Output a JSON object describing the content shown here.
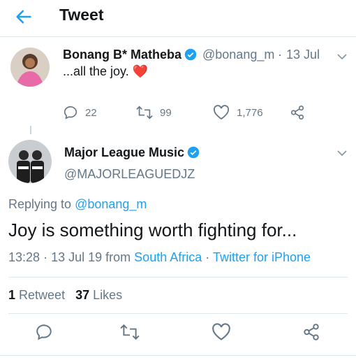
{
  "header": {
    "title": "Tweet"
  },
  "parent_tweet": {
    "display_name": "Bonang B* Matheba",
    "handle": "@bonang_m",
    "separator": "·",
    "date": "13 Jul",
    "text": "...all the joy.",
    "emoji": "❤️",
    "replies": "22",
    "retweets": "99",
    "likes": "1,776"
  },
  "main_tweet": {
    "display_name": "Major League Music",
    "handle": "@MAJORLEAGUEDJZ",
    "replying_prefix": "Replying to",
    "replying_to": "@bonang_m",
    "text": "Joy is something worth fighting for...",
    "time": "13:28",
    "separator": "·",
    "date": "13 Jul 19",
    "from": "from",
    "location": "South Africa",
    "client_separator": "·",
    "client": "Twitter for iPhone",
    "retweet_count": "1",
    "retweet_label": "Retweet",
    "like_count": "37",
    "like_label": "Likes"
  },
  "colors": {
    "accent": "#1da1f2",
    "muted": "#657786",
    "text": "#14171a",
    "divider": "#e1e8ed",
    "heart": "#e0245e"
  },
  "icons": [
    "back-arrow-icon",
    "verified-badge-icon",
    "chevron-down-icon",
    "reply-icon",
    "retweet-icon",
    "like-icon",
    "share-icon"
  ]
}
